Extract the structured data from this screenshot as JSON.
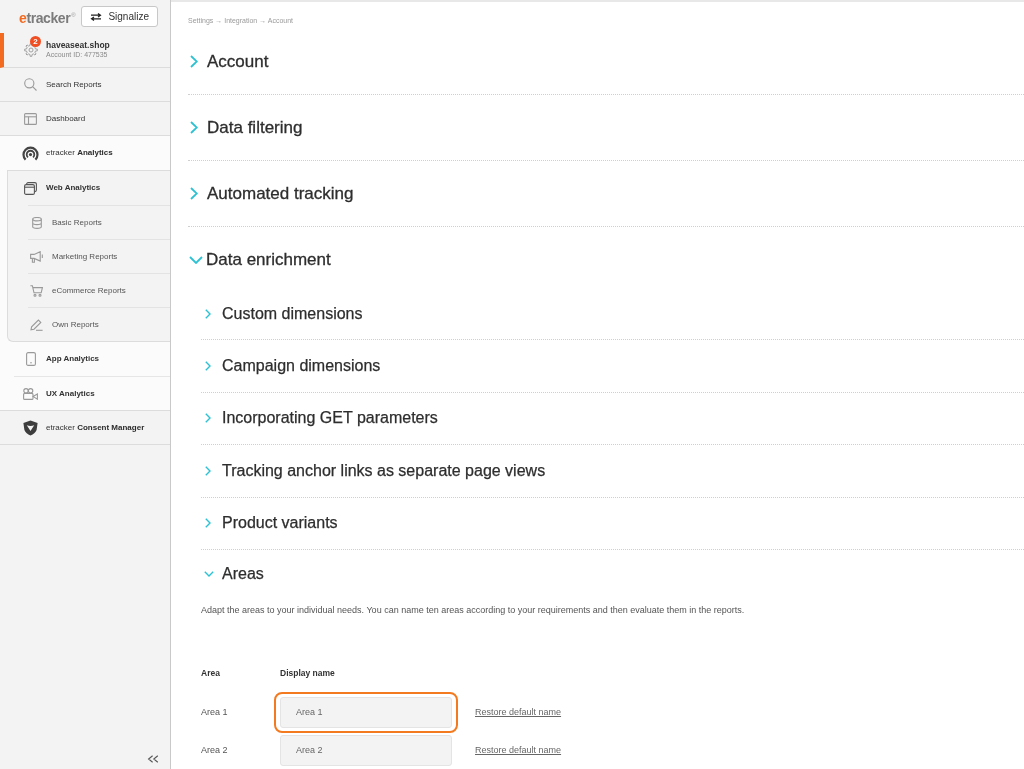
{
  "sidebar": {
    "logo": {
      "accent": "e",
      "text": "tracker",
      "mark": "®"
    },
    "signalize_button": "Signalize",
    "account": {
      "name": "haveaseat.shop",
      "account_id": "Account ID: 477535",
      "badge": "2"
    },
    "items": [
      {
        "label": "Search Reports",
        "expanded": false
      },
      {
        "label": "Dashboard",
        "expanded": false
      },
      {
        "label": "etracker **Analytics**",
        "expanded": true,
        "children": [
          {
            "label": "Web Analytics",
            "expanded": true,
            "children": [
              {
                "label": "Basic Reports"
              },
              {
                "label": "Marketing Reports"
              },
              {
                "label": "eCommerce Reports"
              },
              {
                "label": "Own Reports"
              }
            ]
          },
          {
            "label": "App Analytics",
            "expanded": false
          },
          {
            "label": "UX Analytics",
            "expanded": false
          }
        ]
      },
      {
        "label": "etracker **Consent Manager**",
        "expanded": false
      }
    ]
  },
  "content": {
    "breadcrumb": "Settings → Integration → Account",
    "sections": [
      {
        "title": "Account",
        "expanded": false
      },
      {
        "title": "Data filtering",
        "expanded": false
      },
      {
        "title": "Automated tracking",
        "expanded": false
      },
      {
        "title": "Data enrichment",
        "expanded": true,
        "children": [
          {
            "title": "Custom dimensions",
            "expanded": false
          },
          {
            "title": "Campaign dimensions",
            "expanded": false
          },
          {
            "title": "Incorporating GET parameters",
            "expanded": false
          },
          {
            "title": "Tracking anchor links as separate page views",
            "expanded": false
          },
          {
            "title": "Product variants",
            "expanded": false
          },
          {
            "title": "Areas",
            "expanded": true,
            "description": "Adapt the areas to your individual needs. You can name ten areas according to your requirements and then evaluate them in the reports.",
            "table": {
              "columns": [
                "Area",
                "Display name"
              ],
              "rows": [
                {
                  "area": "Area 1",
                  "display_name": "Area 1",
                  "highlighted": true,
                  "action": "Restore default name"
                },
                {
                  "area": "Area 2",
                  "display_name": "Area 2",
                  "highlighted": false,
                  "action": "Restore default name"
                }
              ]
            }
          }
        ]
      }
    ]
  }
}
